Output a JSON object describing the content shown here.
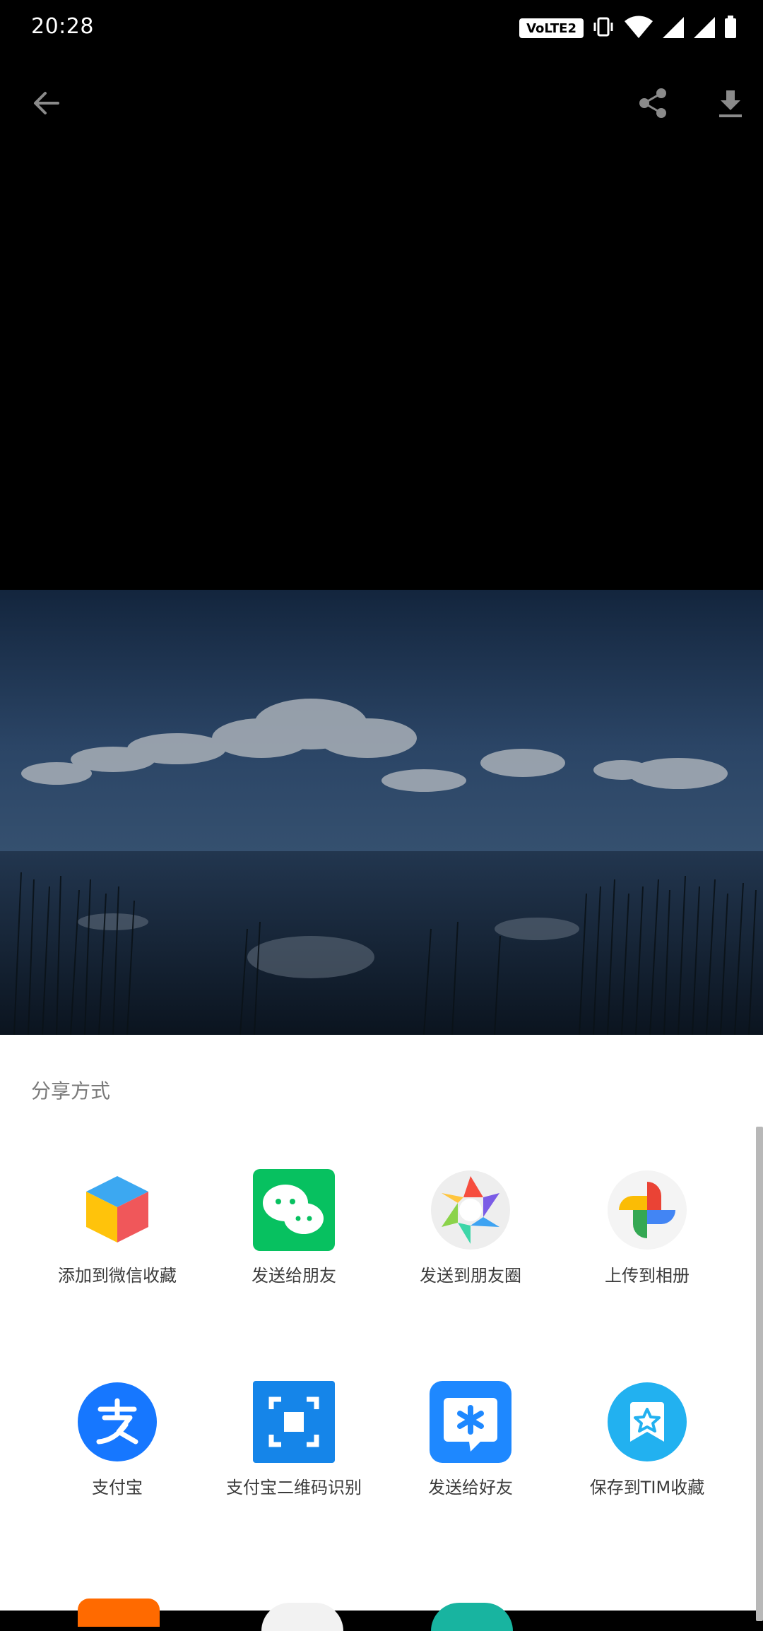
{
  "status_bar": {
    "time": "20:28",
    "network_badge": "VoLTE2",
    "icons": [
      "vibrate-icon",
      "wifi-icon",
      "signal-icon",
      "signal-icon",
      "battery-icon"
    ]
  },
  "toolbar": {
    "icons": [
      "back-arrow-icon",
      "share-icon",
      "download-icon"
    ]
  },
  "sheet": {
    "title": "分享方式",
    "items": [
      {
        "label": "添加到微信收藏",
        "icon": "wechat-favorites-icon"
      },
      {
        "label": "发送给朋友",
        "icon": "wechat-icon"
      },
      {
        "label": "发送到朋友圈",
        "icon": "moments-icon"
      },
      {
        "label": "上传到相册",
        "icon": "google-photos-icon"
      },
      {
        "label": "支付宝",
        "icon": "alipay-icon"
      },
      {
        "label": "支付宝二维码识别",
        "icon": "alipay-scan-icon"
      },
      {
        "label": "发送给好友",
        "icon": "tim-chat-icon"
      },
      {
        "label": "保存到TIM收藏",
        "icon": "tim-favorites-icon"
      }
    ]
  },
  "colors": {
    "wechat_green": "#07C160",
    "alipay_blue": "#1677FF",
    "tim_blue": "#1E88FF"
  }
}
